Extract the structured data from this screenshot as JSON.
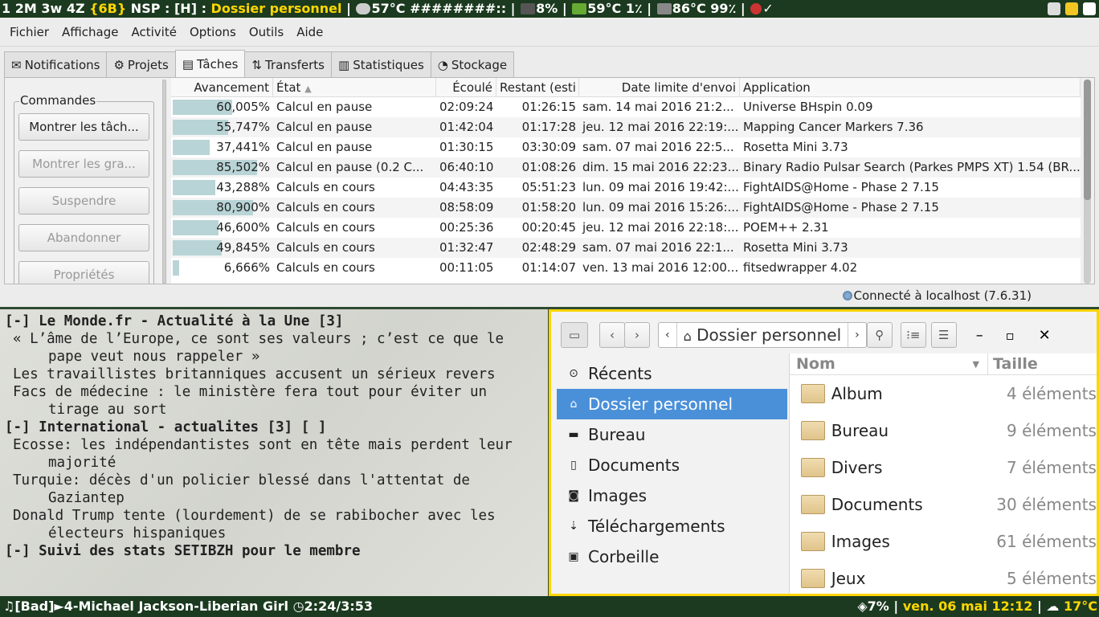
{
  "topbar": {
    "prefix": "1 2M 3w 4Z ",
    "tag": "{6B}",
    "mid": " NSP : [H] : ",
    "title": "Dossier personnel",
    "sep1": " | ",
    "cpu_temp": "57°C ########::",
    "sep2": " | ",
    "ram": "8%",
    "sep3": " | ",
    "gpu": "59°C 1٪",
    "sep4": " | ",
    "disk": "86°C 99٪",
    "sep5": " | ",
    "pi": "✓"
  },
  "boinc": {
    "menu": [
      "Fichier",
      "Affichage",
      "Activité",
      "Options",
      "Outils",
      "Aide"
    ],
    "tabs": [
      "Notifications",
      "Projets",
      "Tâches",
      "Transferts",
      "Statistiques",
      "Stockage"
    ],
    "commands_title": "Commandes",
    "buttons": [
      "Montrer les tâch...",
      "Montrer les gra...",
      "Suspendre",
      "Abandonner",
      "Propriétés"
    ],
    "columns": [
      "Avancement",
      "État",
      "Écoulé",
      "Restant (esti",
      "Date limite d'envoi",
      "Application"
    ],
    "rows": [
      {
        "p": "60,005%",
        "v": 60.005,
        "s": "Calcul en pause",
        "e": "02:09:24",
        "r": "01:26:15",
        "d": "sam. 14 mai 2016 21:2...",
        "a": "Universe BHspin 0.09"
      },
      {
        "p": "55,747%",
        "v": 55.747,
        "s": "Calcul en pause",
        "e": "01:42:04",
        "r": "01:17:28",
        "d": "jeu. 12 mai 2016 22:19:...",
        "a": "Mapping Cancer Markers 7.36"
      },
      {
        "p": "37,441%",
        "v": 37.441,
        "s": "Calcul en pause",
        "e": "01:30:15",
        "r": "03:30:09",
        "d": "sam. 07 mai 2016 22:5...",
        "a": "Rosetta Mini 3.73"
      },
      {
        "p": "85,502%",
        "v": 85.502,
        "s": "Calcul en pause (0.2 C...",
        "e": "06:40:10",
        "r": "01:08:26",
        "d": "dim. 15 mai 2016 22:23...",
        "a": "Binary Radio Pulsar Search (Parkes PMPS XT) 1.54  (BR..."
      },
      {
        "p": "43,288%",
        "v": 43.288,
        "s": "Calculs en cours",
        "e": "04:43:35",
        "r": "05:51:23",
        "d": "lun. 09 mai 2016 19:42:...",
        "a": "FightAIDS@Home - Phase 2 7.15"
      },
      {
        "p": "80,900%",
        "v": 80.9,
        "s": "Calculs en cours",
        "e": "08:58:09",
        "r": "01:58:20",
        "d": "lun. 09 mai 2016 15:26:...",
        "a": "FightAIDS@Home - Phase 2 7.15"
      },
      {
        "p": "46,600%",
        "v": 46.6,
        "s": "Calculs en cours",
        "e": "00:25:36",
        "r": "00:20:45",
        "d": "jeu. 12 mai 2016 22:18:...",
        "a": "POEM++ 2.31"
      },
      {
        "p": "49,845%",
        "v": 49.845,
        "s": "Calculs en cours",
        "e": "01:32:47",
        "r": "02:48:29",
        "d": "sam. 07 mai 2016 22:1...",
        "a": "Rosetta Mini 3.73"
      },
      {
        "p": "6,666%",
        "v": 6.666,
        "s": "Calculs en cours",
        "e": "00:11:05",
        "r": "01:14:07",
        "d": "ven. 13 mai 2016 12:00...",
        "a": "fitsedwrapper 4.02"
      }
    ],
    "status": "Connecté à localhost (7.6.31)"
  },
  "term": {
    "lines": [
      {
        "t": "h",
        "x": "[-] Le Monde.fr - Actualité à la Une [3]"
      },
      {
        "t": "i",
        "x": "« L’âme de l’Europe, ce sont ses valeurs ; c’est ce que le"
      },
      {
        "t": "w",
        "x": "pape veut nous rappeler »"
      },
      {
        "t": "i",
        "x": "Les travaillistes britanniques accusent un sérieux revers"
      },
      {
        "t": "i",
        "x": "Facs de médecine : le ministère fera tout pour éviter un"
      },
      {
        "t": "w",
        "x": "tirage au sort"
      },
      {
        "t": "h",
        "x": "[-] International - actualites [3] [ ]"
      },
      {
        "t": "i",
        "x": "Ecosse: les indépendantistes sont en tête mais perdent leur"
      },
      {
        "t": "w",
        "x": "majorité"
      },
      {
        "t": "i",
        "x": "Turquie: décès d'un policier blessé dans l'attentat de"
      },
      {
        "t": "w",
        "x": "Gaziantep"
      },
      {
        "t": "i",
        "x": "Donald Trump tente (lourdement) de se rabibocher avec les"
      },
      {
        "t": "w",
        "x": "électeurs hispaniques"
      },
      {
        "t": "h",
        "x": "[-] Suivi des stats SETIBZH pour le membre"
      }
    ]
  },
  "fm": {
    "path": "Dossier personnel",
    "sidebar": [
      {
        "icon": "⊙",
        "label": "Récents"
      },
      {
        "icon": "⌂",
        "label": "Dossier personnel",
        "sel": true
      },
      {
        "icon": "▬",
        "label": "Bureau"
      },
      {
        "icon": "▯",
        "label": "Documents"
      },
      {
        "icon": "◙",
        "label": "Images"
      },
      {
        "icon": "⇣",
        "label": "Téléchargements"
      },
      {
        "icon": "▣",
        "label": "Corbeille"
      }
    ],
    "col_name": "Nom",
    "col_size": "Taille",
    "files": [
      {
        "n": "Album",
        "s": "4 éléments"
      },
      {
        "n": "Bureau",
        "s": "9 éléments"
      },
      {
        "n": "Divers",
        "s": "7 éléments"
      },
      {
        "n": "Documents",
        "s": "30 éléments"
      },
      {
        "n": "Images",
        "s": "61 éléments"
      },
      {
        "n": "Jeux",
        "s": "5 éléments"
      }
    ]
  },
  "botbar": {
    "track": "[Bad]►4-Michael Jackson-Liberian Girl ",
    "time": "2:24/3:53",
    "vol": "7%",
    "sep": " | ",
    "date": "ven. 06 mai 12:12",
    "sep2": " | ",
    "temp": "17°C"
  }
}
